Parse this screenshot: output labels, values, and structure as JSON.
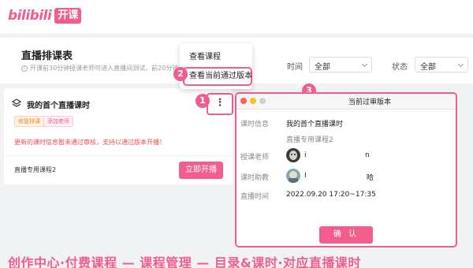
{
  "brand": {
    "logo_text": "bilibili",
    "badge_text": "开课"
  },
  "header": {
    "title": "直播排课表",
    "notice": "开课前30分钟授课老师可进入直播间测试，前20分钟",
    "filters": [
      {
        "label": "时间",
        "value": "全部"
      },
      {
        "label": "状态",
        "value": "全部"
      }
    ]
  },
  "dropdown_menu": {
    "items": [
      {
        "label": "查看课程",
        "highlighted": false
      },
      {
        "label": "查看当前通过版本",
        "highlighted": true
      }
    ]
  },
  "course_card": {
    "title": "我的首个直播课时",
    "tags": [
      "修复排课",
      "添加老师"
    ],
    "warning": "更新的课时信息暂未通过审核，支持以通过版本开播！",
    "course_name": "直播专用课程2",
    "more_label": "⋮",
    "start_button": "立即开播"
  },
  "step_badges": [
    "1",
    "2",
    "3"
  ],
  "modal": {
    "title": "当前过审版本",
    "rows": [
      {
        "label": "课时信息",
        "value": "我的首个直播课时"
      },
      {
        "label": "",
        "value": "直播专用课程2"
      },
      {
        "label": "授课老师",
        "value": "i",
        "value2": "n"
      },
      {
        "label": "课时助教",
        "value": "I",
        "value2": "哈"
      },
      {
        "label": "直播时间",
        "value": "2022.09.20 17:20~17:35"
      }
    ],
    "confirm_label": "确 认"
  },
  "footer_caption": "创作中心·付费课程 — 课程管理 — 目录&课时·对应直播课时",
  "colors": {
    "accent": "#f25d8e",
    "warning": "#f24c4c"
  }
}
